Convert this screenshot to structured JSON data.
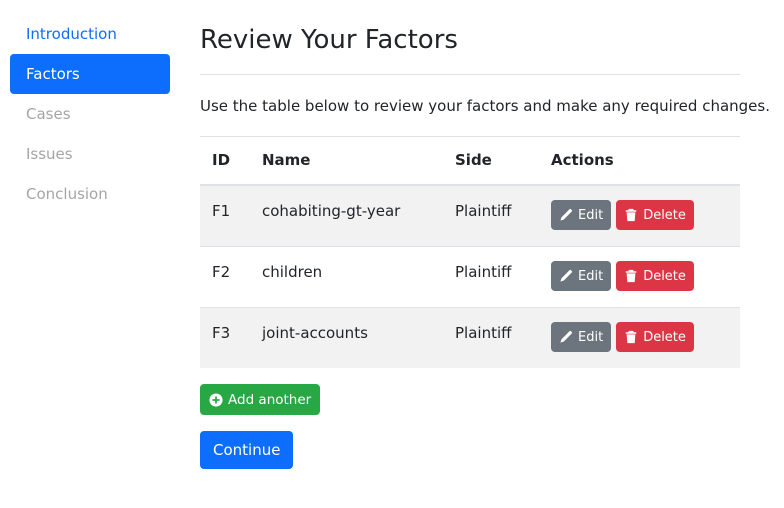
{
  "sidebar": {
    "items": [
      {
        "label": "Introduction",
        "state": "visited"
      },
      {
        "label": "Factors",
        "state": "active"
      },
      {
        "label": "Cases",
        "state": "disabled"
      },
      {
        "label": "Issues",
        "state": "disabled"
      },
      {
        "label": "Conclusion",
        "state": "disabled"
      }
    ]
  },
  "main": {
    "title": "Review Your Factors",
    "description": "Use the table below to review your factors and make any required changes."
  },
  "table": {
    "headers": {
      "id": "ID",
      "name": "Name",
      "side": "Side",
      "actions": "Actions"
    },
    "rows": [
      {
        "id": "F1",
        "name": "cohabiting-gt-year",
        "side": "Plaintiff"
      },
      {
        "id": "F2",
        "name": "children",
        "side": "Plaintiff"
      },
      {
        "id": "F3",
        "name": "joint-accounts",
        "side": "Plaintiff"
      }
    ],
    "edit_label": "Edit",
    "delete_label": "Delete"
  },
  "buttons": {
    "add_label": "Add another",
    "continue_label": "Continue"
  },
  "colors": {
    "primary": "#0d6efd",
    "secondary": "#6c757d",
    "danger": "#dc3545",
    "success": "#28a745",
    "muted": "#a5a5a5"
  },
  "icons": {
    "edit": "pencil-icon",
    "delete": "trash-icon",
    "add": "plus-circle-icon"
  }
}
